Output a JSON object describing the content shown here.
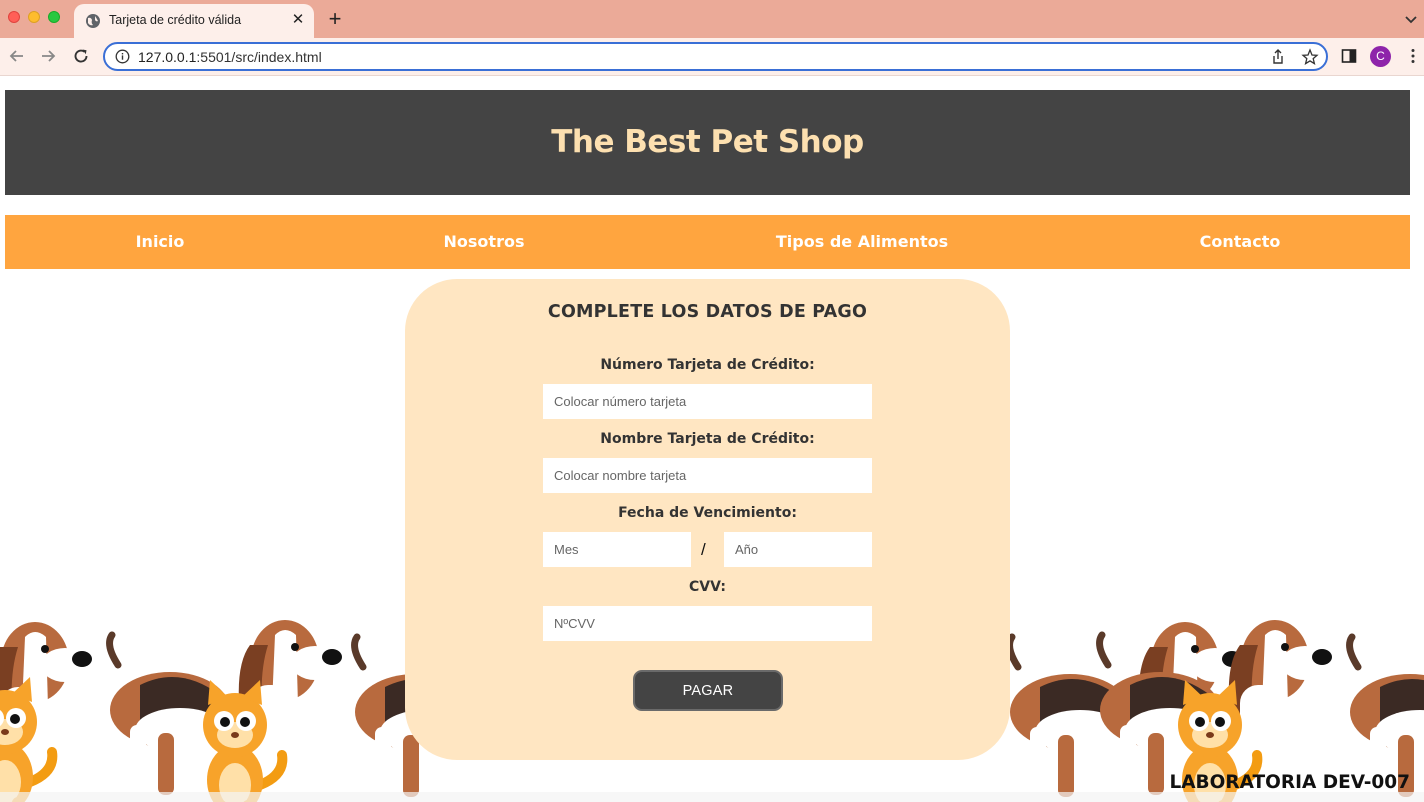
{
  "browser": {
    "tab_title": "Tarjeta de crédito válida",
    "url_host": "127.0.0.1",
    "url_path": ":5501/src/index.html",
    "profile_initial": "C"
  },
  "header": {
    "title": "The Best Pet Shop"
  },
  "nav": {
    "items": [
      "Inicio",
      "Nosotros",
      "Tipos de Alimentos",
      "Contacto"
    ]
  },
  "form": {
    "title": "COMPLETE LOS DATOS DE PAGO",
    "card_number_label": "Número Tarjeta de Crédito:",
    "card_number_placeholder": "Colocar número tarjeta",
    "card_name_label": "Nombre Tarjeta de Crédito:",
    "card_name_placeholder": "Colocar nombre tarjeta",
    "expiry_label": "Fecha de Vencimiento:",
    "month_placeholder": "Mes",
    "separator": "/",
    "year_placeholder": "Año",
    "cvv_label": "CVV:",
    "cvv_placeholder": "NºCVV",
    "submit_label": "PAGAR"
  },
  "footer": {
    "lab": "LABORATORIA DEV-007"
  },
  "colors": {
    "header_bg": "#444444",
    "title_color": "#FDE0B0",
    "nav_bg": "#FFA53F",
    "card_bg": "#FFE6C2"
  },
  "icons": {
    "decoration": [
      "beagle-dog-icon",
      "orange-cat-icon"
    ]
  }
}
